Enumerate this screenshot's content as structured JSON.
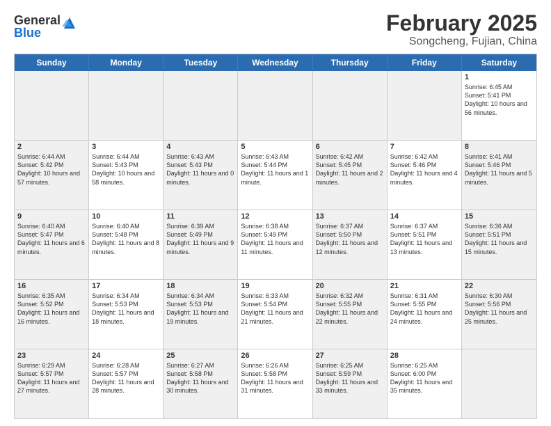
{
  "logo": {
    "general": "General",
    "blue": "Blue"
  },
  "title": "February 2025",
  "subtitle": "Songcheng, Fujian, China",
  "header_days": [
    "Sunday",
    "Monday",
    "Tuesday",
    "Wednesday",
    "Thursday",
    "Friday",
    "Saturday"
  ],
  "weeks": [
    [
      {
        "day": "",
        "text": "",
        "shaded": true
      },
      {
        "day": "",
        "text": "",
        "shaded": true
      },
      {
        "day": "",
        "text": "",
        "shaded": true
      },
      {
        "day": "",
        "text": "",
        "shaded": true
      },
      {
        "day": "",
        "text": "",
        "shaded": true
      },
      {
        "day": "",
        "text": "",
        "shaded": true
      },
      {
        "day": "1",
        "text": "Sunrise: 6:45 AM\nSunset: 5:41 PM\nDaylight: 10 hours and 56 minutes.",
        "shaded": false
      }
    ],
    [
      {
        "day": "2",
        "text": "Sunrise: 6:44 AM\nSunset: 5:42 PM\nDaylight: 10 hours and 57 minutes.",
        "shaded": true
      },
      {
        "day": "3",
        "text": "Sunrise: 6:44 AM\nSunset: 5:43 PM\nDaylight: 10 hours and 58 minutes.",
        "shaded": false
      },
      {
        "day": "4",
        "text": "Sunrise: 6:43 AM\nSunset: 5:43 PM\nDaylight: 11 hours and 0 minutes.",
        "shaded": true
      },
      {
        "day": "5",
        "text": "Sunrise: 6:43 AM\nSunset: 5:44 PM\nDaylight: 11 hours and 1 minute.",
        "shaded": false
      },
      {
        "day": "6",
        "text": "Sunrise: 6:42 AM\nSunset: 5:45 PM\nDaylight: 11 hours and 2 minutes.",
        "shaded": true
      },
      {
        "day": "7",
        "text": "Sunrise: 6:42 AM\nSunset: 5:46 PM\nDaylight: 11 hours and 4 minutes.",
        "shaded": false
      },
      {
        "day": "8",
        "text": "Sunrise: 6:41 AM\nSunset: 5:46 PM\nDaylight: 11 hours and 5 minutes.",
        "shaded": true
      }
    ],
    [
      {
        "day": "9",
        "text": "Sunrise: 6:40 AM\nSunset: 5:47 PM\nDaylight: 11 hours and 6 minutes.",
        "shaded": true
      },
      {
        "day": "10",
        "text": "Sunrise: 6:40 AM\nSunset: 5:48 PM\nDaylight: 11 hours and 8 minutes.",
        "shaded": false
      },
      {
        "day": "11",
        "text": "Sunrise: 6:39 AM\nSunset: 5:49 PM\nDaylight: 11 hours and 9 minutes.",
        "shaded": true
      },
      {
        "day": "12",
        "text": "Sunrise: 6:38 AM\nSunset: 5:49 PM\nDaylight: 11 hours and 11 minutes.",
        "shaded": false
      },
      {
        "day": "13",
        "text": "Sunrise: 6:37 AM\nSunset: 5:50 PM\nDaylight: 11 hours and 12 minutes.",
        "shaded": true
      },
      {
        "day": "14",
        "text": "Sunrise: 6:37 AM\nSunset: 5:51 PM\nDaylight: 11 hours and 13 minutes.",
        "shaded": false
      },
      {
        "day": "15",
        "text": "Sunrise: 6:36 AM\nSunset: 5:51 PM\nDaylight: 11 hours and 15 minutes.",
        "shaded": true
      }
    ],
    [
      {
        "day": "16",
        "text": "Sunrise: 6:35 AM\nSunset: 5:52 PM\nDaylight: 11 hours and 16 minutes.",
        "shaded": true
      },
      {
        "day": "17",
        "text": "Sunrise: 6:34 AM\nSunset: 5:53 PM\nDaylight: 11 hours and 18 minutes.",
        "shaded": false
      },
      {
        "day": "18",
        "text": "Sunrise: 6:34 AM\nSunset: 5:53 PM\nDaylight: 11 hours and 19 minutes.",
        "shaded": true
      },
      {
        "day": "19",
        "text": "Sunrise: 6:33 AM\nSunset: 5:54 PM\nDaylight: 11 hours and 21 minutes.",
        "shaded": false
      },
      {
        "day": "20",
        "text": "Sunrise: 6:32 AM\nSunset: 5:55 PM\nDaylight: 11 hours and 22 minutes.",
        "shaded": true
      },
      {
        "day": "21",
        "text": "Sunrise: 6:31 AM\nSunset: 5:55 PM\nDaylight: 11 hours and 24 minutes.",
        "shaded": false
      },
      {
        "day": "22",
        "text": "Sunrise: 6:30 AM\nSunset: 5:56 PM\nDaylight: 11 hours and 25 minutes.",
        "shaded": true
      }
    ],
    [
      {
        "day": "23",
        "text": "Sunrise: 6:29 AM\nSunset: 5:57 PM\nDaylight: 11 hours and 27 minutes.",
        "shaded": true
      },
      {
        "day": "24",
        "text": "Sunrise: 6:28 AM\nSunset: 5:57 PM\nDaylight: 11 hours and 28 minutes.",
        "shaded": false
      },
      {
        "day": "25",
        "text": "Sunrise: 6:27 AM\nSunset: 5:58 PM\nDaylight: 11 hours and 30 minutes.",
        "shaded": true
      },
      {
        "day": "26",
        "text": "Sunrise: 6:26 AM\nSunset: 5:58 PM\nDaylight: 11 hours and 31 minutes.",
        "shaded": false
      },
      {
        "day": "27",
        "text": "Sunrise: 6:25 AM\nSunset: 5:59 PM\nDaylight: 11 hours and 33 minutes.",
        "shaded": true
      },
      {
        "day": "28",
        "text": "Sunrise: 6:25 AM\nSunset: 6:00 PM\nDaylight: 11 hours and 35 minutes.",
        "shaded": false
      },
      {
        "day": "",
        "text": "",
        "shaded": true
      }
    ]
  ]
}
